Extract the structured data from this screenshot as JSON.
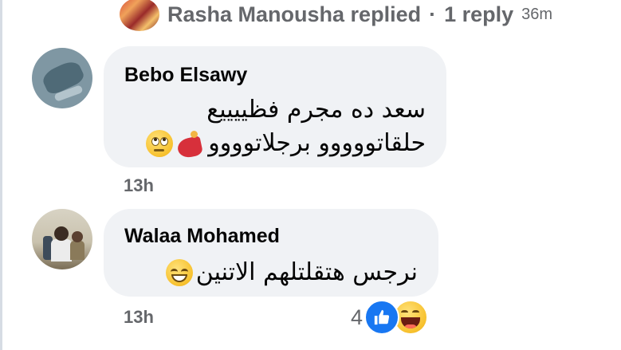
{
  "reply_summary": {
    "text": "Rasha Manousha replied",
    "separator": "·",
    "count_label": "1 reply",
    "time": "36m"
  },
  "comments": [
    {
      "author": "Bebo Elsawy",
      "lines": [
        "سعد ده مجرم فظييييع",
        "حلقاتووووو برجلاتوووو"
      ],
      "emojis": [
        "face-rolling-eyes-emoji",
        "woman-dancing-emoji"
      ],
      "time": "13h"
    },
    {
      "author": "Walaa Mohamed",
      "lines": [
        "نرجس هتقلتلهم الاتنين"
      ],
      "emojis": [
        "grinning-smiling-eyes-emoji"
      ],
      "time": "13h",
      "reactions": {
        "count": "4",
        "icons": [
          "like-icon",
          "haha-icon"
        ],
        "like_color": "#1877f2"
      }
    }
  ],
  "colors": {
    "bubble": "#f0f2f5",
    "secondary_text": "#65676b",
    "primary_text": "#050505"
  }
}
